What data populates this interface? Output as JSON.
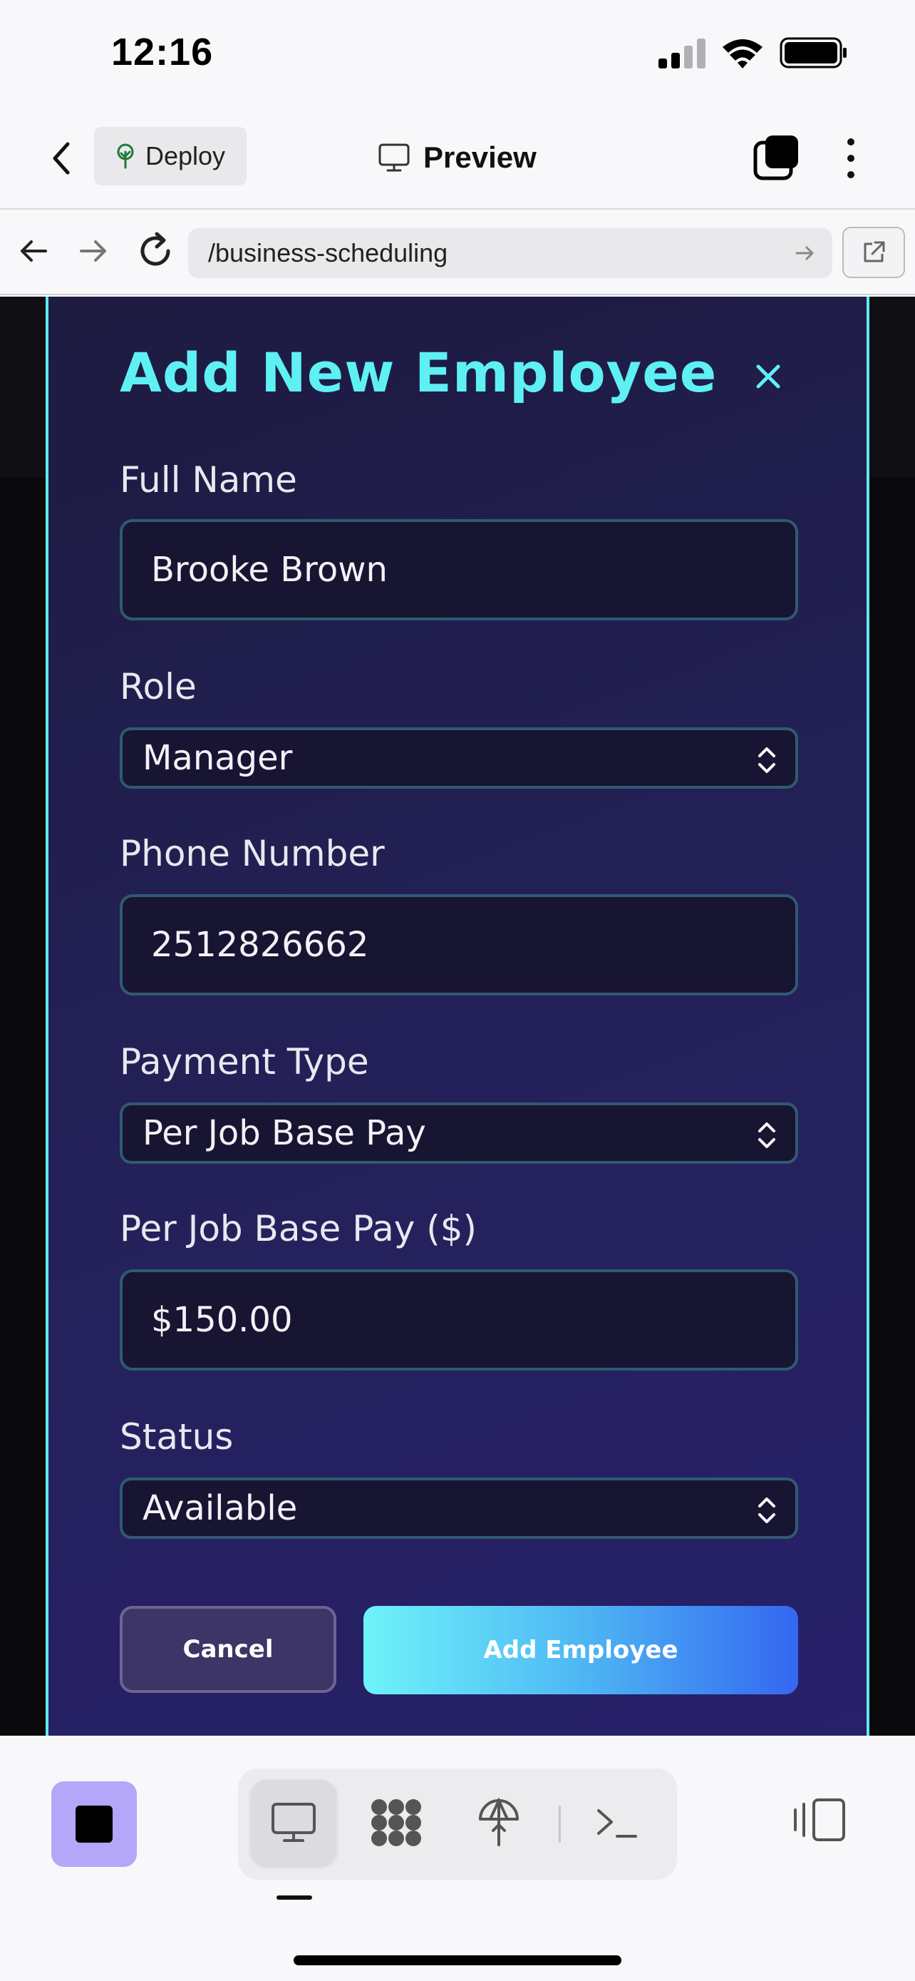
{
  "status_bar": {
    "time": "12:16"
  },
  "app_bar": {
    "deploy_label": "Deploy",
    "preview_label": "Preview"
  },
  "url_bar": {
    "url": "/business-scheduling"
  },
  "modal": {
    "title": "Add New Employee",
    "close_symbol": "×",
    "fields": {
      "full_name": {
        "label": "Full Name",
        "value": "Brooke Brown"
      },
      "role": {
        "label": "Role",
        "value": "Manager"
      },
      "phone": {
        "label": "Phone Number",
        "value": "2512826662"
      },
      "payment_type": {
        "label": "Payment Type",
        "value": "Per Job Base Pay"
      },
      "base_pay": {
        "label": "Per Job Base Pay ($)",
        "value": "$150.00"
      },
      "status": {
        "label": "Status",
        "value": "Available"
      }
    },
    "cancel_label": "Cancel",
    "submit_label": "Add Employee"
  },
  "colors": {
    "accent_cyan": "#5ff0f4",
    "modal_bg": "#24215a",
    "button_gradient_start": "#6ef3f9",
    "button_gradient_end": "#3467f0",
    "stop_button": "#b4a6f8"
  },
  "icons": {
    "app_bar": [
      "back-chevron-icon",
      "tree-icon",
      "monitor-icon",
      "tabs-icon",
      "more-vertical-icon"
    ],
    "url_bar": [
      "arrow-left-icon",
      "arrow-right-icon",
      "reload-icon",
      "go-arrow-icon",
      "external-link-icon"
    ],
    "toolbar": [
      "stop-icon",
      "monitor-icon",
      "grid-icon",
      "deploy-umbrella-icon",
      "terminal-icon",
      "layout-toggle-icon"
    ]
  }
}
